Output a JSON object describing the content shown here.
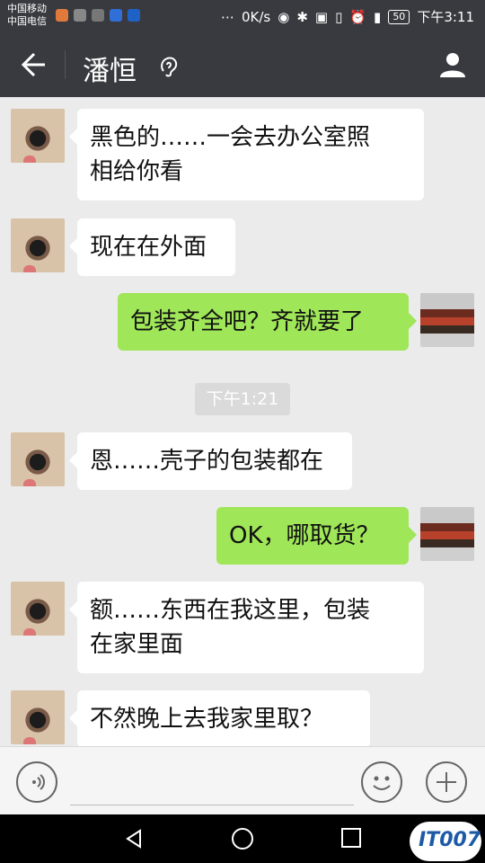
{
  "status_bar": {
    "carrier_1": "中国移动",
    "carrier_2": "中国电信",
    "network_speed": "0K/s",
    "battery": "50",
    "time": "下午3:11"
  },
  "header": {
    "contact_name": "潘恒",
    "back_icon": "back-arrow-icon",
    "mode_icon": "ear-icon",
    "profile_icon": "person-icon"
  },
  "messages": [
    {
      "side": "left",
      "text_line1": "黑色的……一会去办公室照",
      "text_line2": "相给你看"
    },
    {
      "side": "left",
      "text": "现在在外面"
    },
    {
      "side": "right",
      "text": "包装齐全吧？齐就要了"
    },
    {
      "type": "timestamp",
      "text": "下午1:21"
    },
    {
      "side": "left",
      "text": "恩……壳子的包装都在"
    },
    {
      "side": "right",
      "text": "OK，哪取货？"
    },
    {
      "side": "left",
      "text_line1": "额……东西在我这里，包装",
      "text_line2": "在家里面"
    },
    {
      "side": "left",
      "text": "不然晚上去我家里取？"
    }
  ],
  "input_bar": {
    "voice_icon": "voice-icon",
    "emoji_icon": "emoji-icon",
    "plus_icon": "plus-icon",
    "input_value": ""
  },
  "watermark": "IT007",
  "colors": {
    "header_bg": "#393a3f",
    "chat_bg": "#ebebeb",
    "bubble_right": "#9fe658",
    "bubble_left": "#ffffff"
  }
}
